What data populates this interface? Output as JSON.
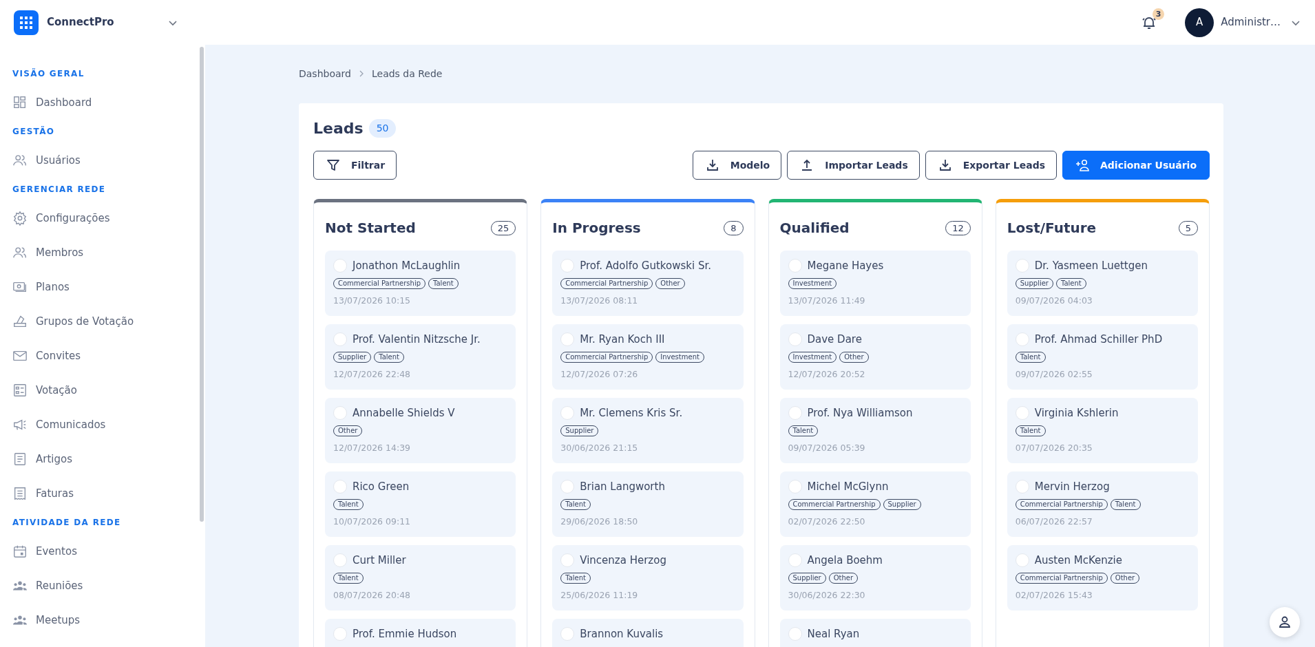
{
  "app": {
    "name": "ConnectPro"
  },
  "header": {
    "notifications": "3",
    "user": {
      "initial": "A",
      "name": "Administr…"
    }
  },
  "sidebar": {
    "sections": [
      {
        "title": "VISÃO GERAL",
        "items": [
          {
            "label": "Dashboard"
          }
        ]
      },
      {
        "title": "GESTÃO",
        "items": [
          {
            "label": "Usuários"
          }
        ]
      },
      {
        "title": "GERENCIAR REDE",
        "items": [
          {
            "label": "Configurações"
          },
          {
            "label": "Membros"
          },
          {
            "label": "Planos"
          },
          {
            "label": "Grupos de Votação"
          },
          {
            "label": "Convites"
          },
          {
            "label": "Votação"
          },
          {
            "label": "Comunicados"
          },
          {
            "label": "Artigos"
          },
          {
            "label": "Faturas"
          }
        ]
      },
      {
        "title": "ATIVIDADE DA REDE",
        "items": [
          {
            "label": "Eventos"
          },
          {
            "label": "Reuniões"
          },
          {
            "label": "Meetups"
          }
        ]
      }
    ]
  },
  "breadcrumb": [
    "Dashboard",
    "Leads da Rede"
  ],
  "page": {
    "title": "Leads",
    "count": "50"
  },
  "toolbar": {
    "filter": "Filtrar",
    "buttons": [
      {
        "label": "Modelo",
        "kind": "download",
        "primary": false
      },
      {
        "label": "Importar Leads",
        "kind": "upload",
        "primary": false
      },
      {
        "label": "Exportar Leads",
        "kind": "download",
        "primary": false
      },
      {
        "label": "Adicionar Usuário",
        "kind": "add-user",
        "primary": true
      }
    ]
  },
  "columns": [
    {
      "title": "Not Started",
      "count": "25",
      "color": "#6b7280",
      "leads": [
        {
          "name": "Jonathon McLaughlin",
          "selected": false,
          "tags": [
            "Commercial Partnership",
            "Talent"
          ],
          "date": "13/07/2026 10:15"
        },
        {
          "name": "Prof. Valentin Nitzsche Jr.",
          "selected": false,
          "tags": [
            "Supplier",
            "Talent"
          ],
          "date": "12/07/2026 22:48"
        },
        {
          "name": "Annabelle Shields V",
          "selected": false,
          "tags": [
            "Other"
          ],
          "date": "12/07/2026 14:39"
        },
        {
          "name": "Rico Green",
          "selected": false,
          "tags": [
            "Talent"
          ],
          "date": "10/07/2026 09:11"
        },
        {
          "name": "Curt Miller",
          "selected": false,
          "tags": [
            "Talent"
          ],
          "date": "08/07/2026 20:48"
        },
        {
          "name": "Prof. Emmie Hudson",
          "selected": false
        }
      ]
    },
    {
      "title": "In Progress",
      "count": "8",
      "color": "#3b82f6",
      "leads": [
        {
          "name": "Prof. Adolfo Gutkowski Sr.",
          "selected": false,
          "tags": [
            "Commercial Partnership",
            "Other"
          ],
          "date": "13/07/2026 08:11"
        },
        {
          "name": "Mr. Ryan Koch III",
          "selected": false,
          "tags": [
            "Commercial Partnership",
            "Investment"
          ],
          "date": "12/07/2026 07:26"
        },
        {
          "name": "Mr. Clemens Kris Sr.",
          "selected": false,
          "tags": [
            "Supplier"
          ],
          "date": "30/06/2026 21:15"
        },
        {
          "name": "Brian Langworth",
          "selected": false,
          "tags": [
            "Talent"
          ],
          "date": "29/06/2026 18:50"
        },
        {
          "name": "Vincenza Herzog",
          "selected": false,
          "tags": [
            "Talent"
          ],
          "date": "25/06/2026 11:19"
        },
        {
          "name": "Brannon Kuvalis",
          "selected": false
        }
      ]
    },
    {
      "title": "Qualified",
      "count": "12",
      "color": "#22b573",
      "leads": [
        {
          "name": "Megane Hayes",
          "selected": false,
          "tags": [
            "Investment"
          ],
          "date": "13/07/2026 11:49"
        },
        {
          "name": "Dave Dare",
          "selected": false,
          "tags": [
            "Investment",
            "Other"
          ],
          "date": "12/07/2026 20:52"
        },
        {
          "name": "Prof. Nya Williamson",
          "selected": false,
          "tags": [
            "Talent"
          ],
          "date": "09/07/2026 05:39"
        },
        {
          "name": "Michel McGlynn",
          "selected": false,
          "tags": [
            "Commercial Partnership",
            "Supplier"
          ],
          "date": "02/07/2026 22:50"
        },
        {
          "name": "Angela Boehm",
          "selected": false,
          "tags": [
            "Supplier",
            "Other"
          ],
          "date": "30/06/2026 22:30"
        },
        {
          "name": "Neal Ryan",
          "selected": false
        }
      ]
    },
    {
      "title": "Lost/Future",
      "count": "5",
      "color": "#f59e0b",
      "leads": [
        {
          "name": "Dr. Yasmeen Luettgen",
          "selected": false,
          "tags": [
            "Supplier",
            "Talent"
          ],
          "date": "09/07/2026 04:03"
        },
        {
          "name": "Prof. Ahmad Schiller PhD",
          "selected": false,
          "tags": [
            "Talent"
          ],
          "date": "09/07/2026 02:55"
        },
        {
          "name": "Virginia Kshlerin",
          "selected": false,
          "tags": [
            "Talent"
          ],
          "date": "07/07/2026 20:35"
        },
        {
          "name": "Mervin Herzog",
          "selected": false,
          "tags": [
            "Commercial Partnership",
            "Talent"
          ],
          "date": "06/07/2026 22:57"
        },
        {
          "name": "Austen McKenzie",
          "selected": false,
          "tags": [
            "Commercial Partnership",
            "Other"
          ],
          "date": "02/07/2026 15:43"
        }
      ]
    }
  ]
}
